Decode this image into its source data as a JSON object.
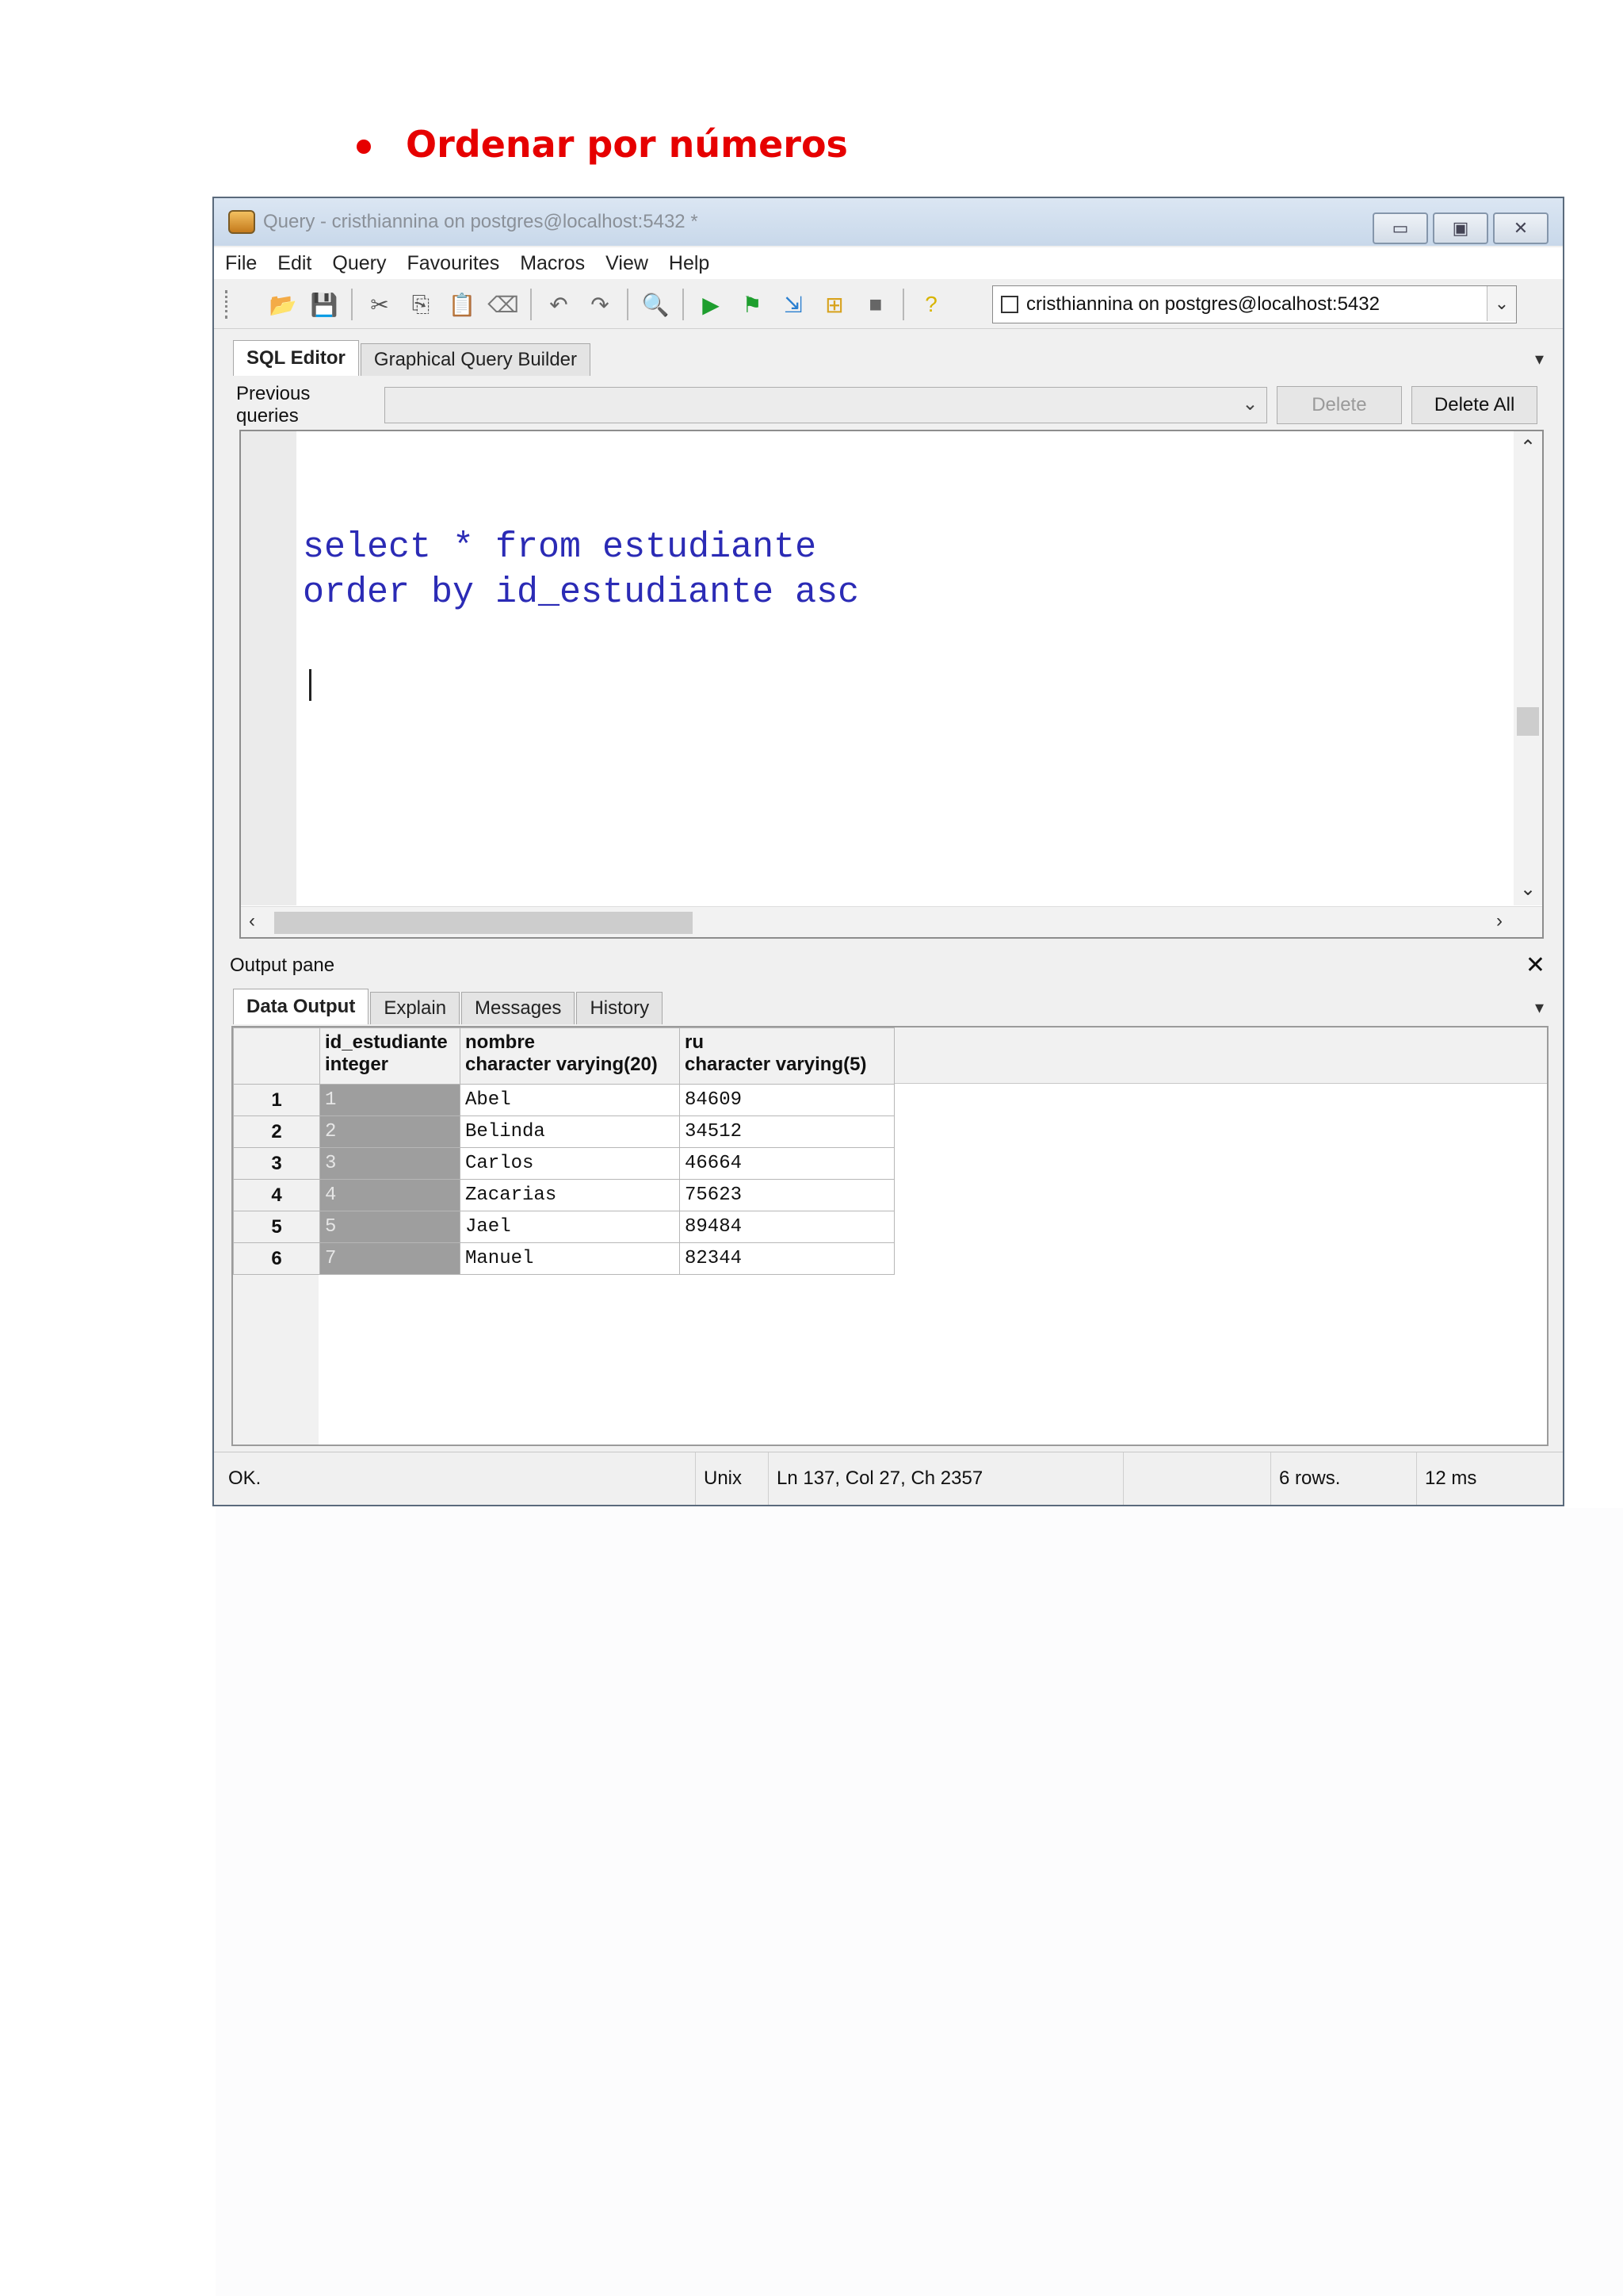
{
  "heading": "Ordenar por números",
  "window": {
    "title": "Query - cristhiannina on postgres@localhost:5432 *",
    "menu": [
      "File",
      "Edit",
      "Query",
      "Favourites",
      "Macros",
      "View",
      "Help"
    ],
    "connection": "cristhiannina on postgres@localhost:5432",
    "editor_tabs": [
      "SQL Editor",
      "Graphical Query Builder"
    ],
    "previous_queries_label": "Previous queries",
    "previous_queries_value": "",
    "delete_label": "Delete",
    "delete_all_label": "Delete All",
    "sql": "select * from estudiante\norder by id_estudiante asc",
    "output_pane_label": "Output pane",
    "output_tabs": [
      "Data Output",
      "Explain",
      "Messages",
      "History"
    ],
    "columns": [
      {
        "name": "id_estudiante",
        "type": "integer"
      },
      {
        "name": "nombre",
        "type": "character varying(20)"
      },
      {
        "name": "ru",
        "type": "character varying(5)"
      }
    ],
    "rows": [
      {
        "n": "1",
        "id": "1",
        "nombre": "Abel",
        "ru": "84609"
      },
      {
        "n": "2",
        "id": "2",
        "nombre": "Belinda",
        "ru": "34512"
      },
      {
        "n": "3",
        "id": "3",
        "nombre": "Carlos",
        "ru": "46664"
      },
      {
        "n": "4",
        "id": "4",
        "nombre": "Zacarias",
        "ru": "75623"
      },
      {
        "n": "5",
        "id": "5",
        "nombre": "Jael",
        "ru": "89484"
      },
      {
        "n": "6",
        "id": "7",
        "nombre": "Manuel",
        "ru": "82344"
      }
    ],
    "status": {
      "state": "OK.",
      "eol": "Unix",
      "position": "Ln 137, Col 27, Ch 2357",
      "rows": "6 rows.",
      "time": "12 ms"
    }
  },
  "colors": {
    "heading": "#e60000",
    "sql_text": "#2b2bb5",
    "id_cell": "#9e9e9e"
  }
}
